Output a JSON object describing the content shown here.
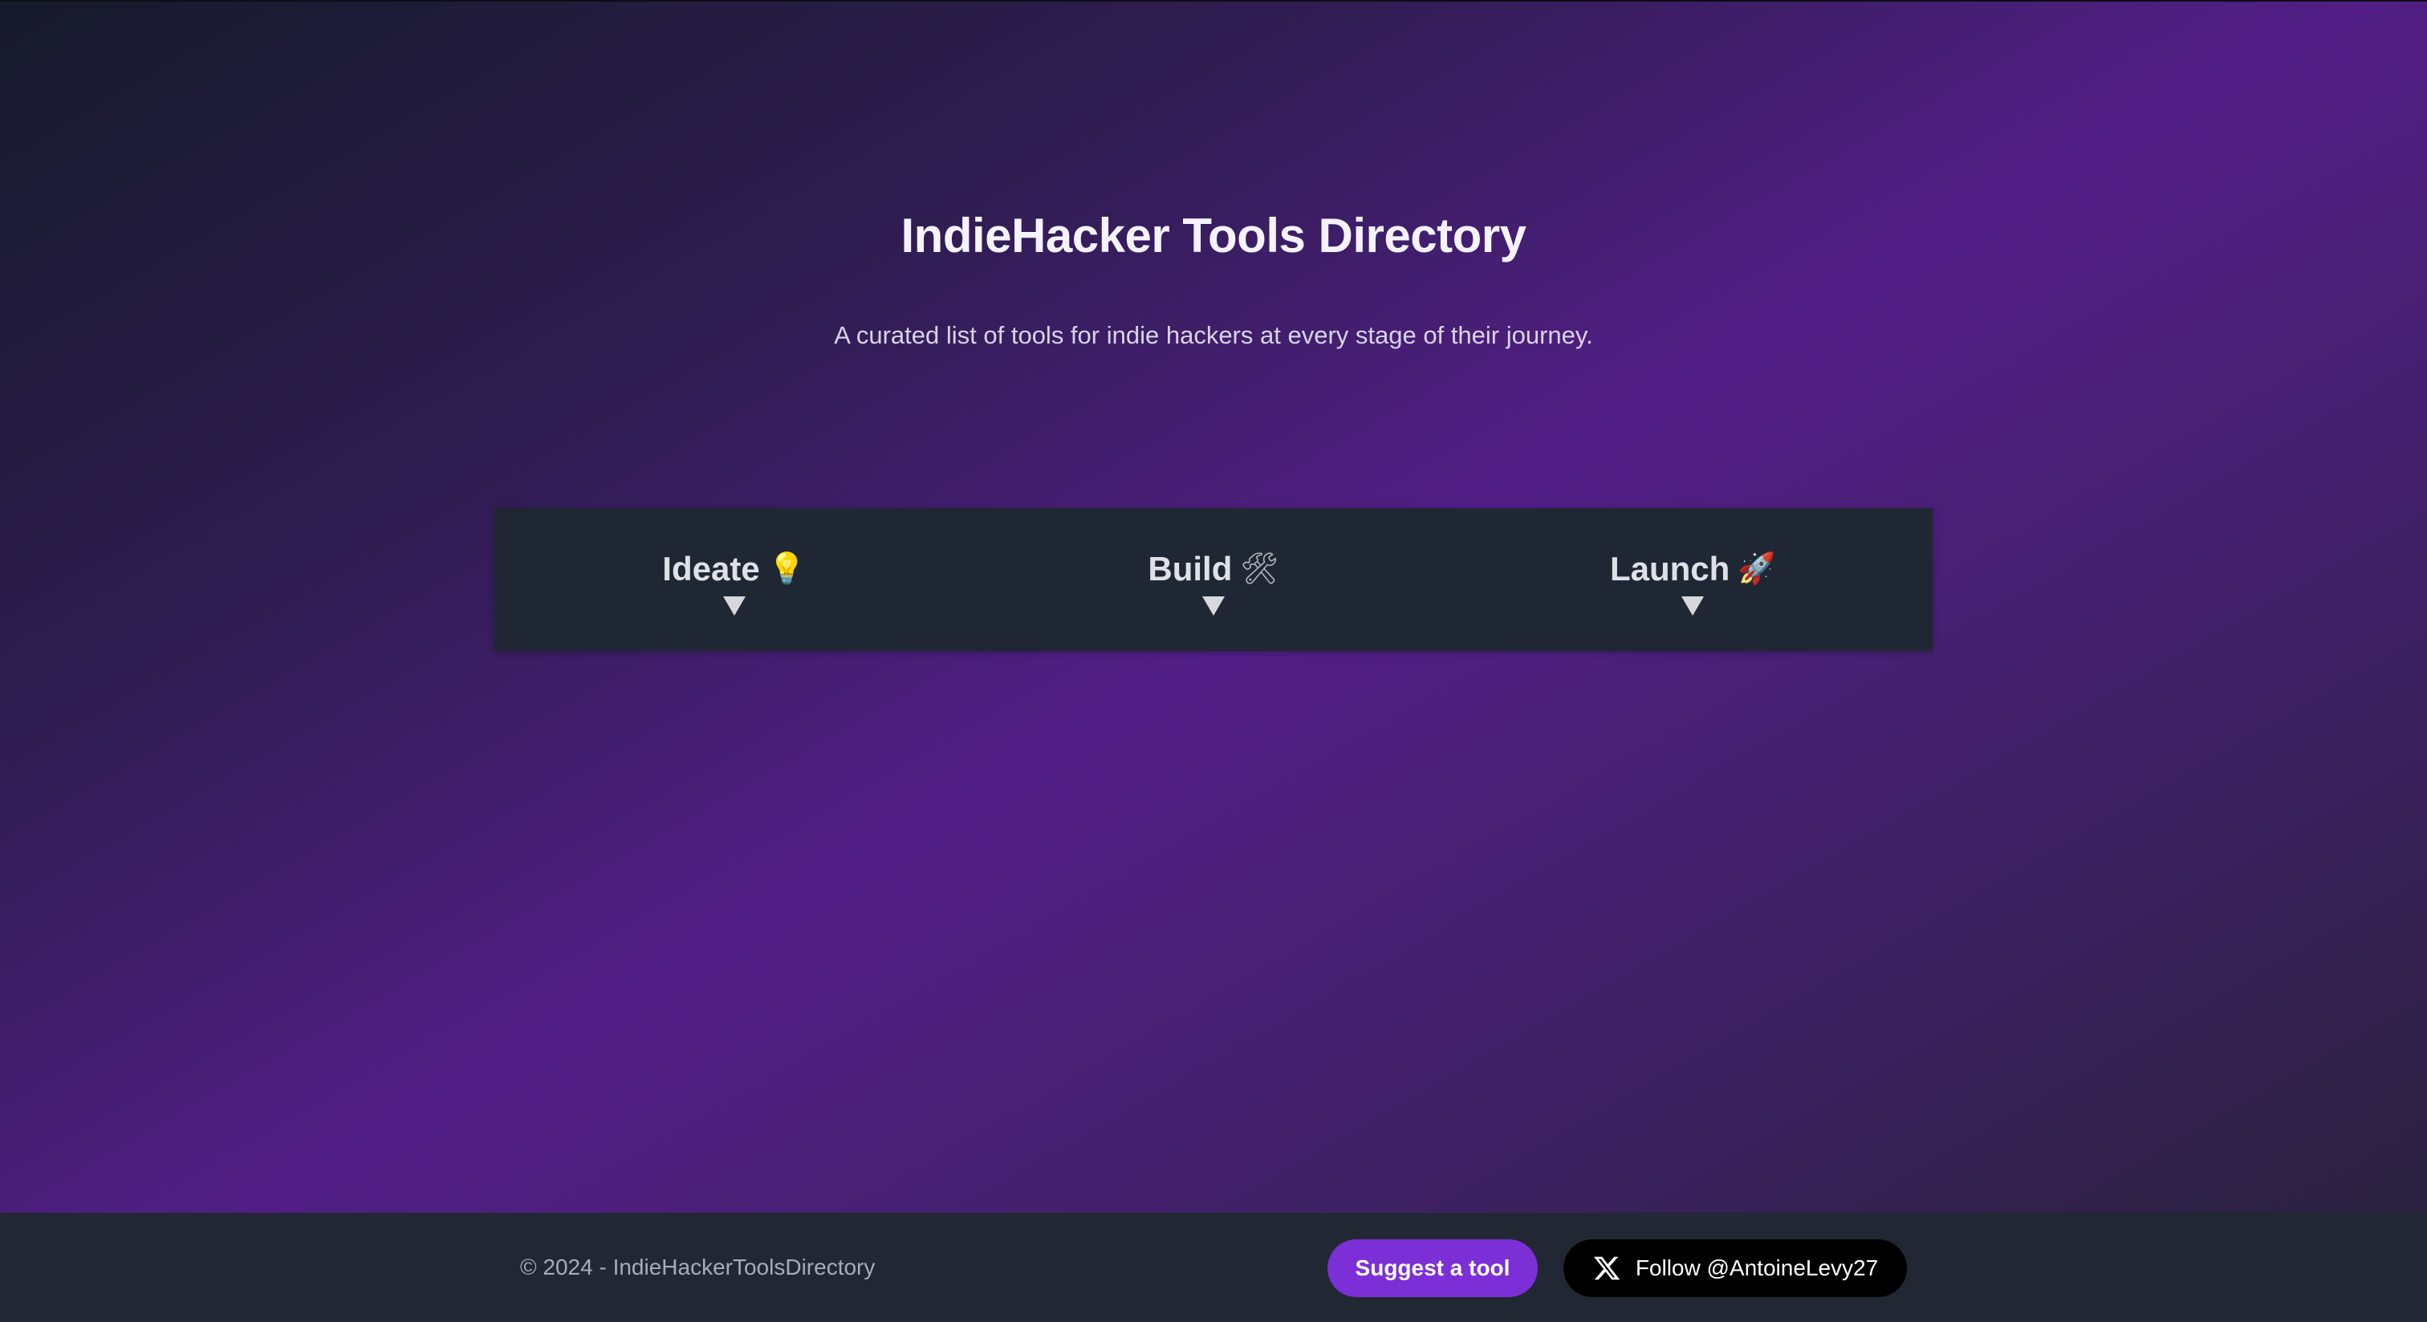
{
  "hero": {
    "title": "IndieHacker Tools Directory",
    "subtitle": "A curated list of tools for indie hackers at every stage of their journey."
  },
  "stages": [
    {
      "label": "Ideate",
      "icon": "lightbulb-icon",
      "glyph": "💡"
    },
    {
      "label": "Build",
      "icon": "tools-icon",
      "glyph": "🛠"
    },
    {
      "label": "Launch",
      "icon": "rocket-icon",
      "glyph": "🚀"
    }
  ],
  "footer": {
    "copyright": "© 2024 - IndieHackerToolsDirectory",
    "suggest_label": "Suggest a tool",
    "follow_label": "Follow @AntoineLevy27",
    "follow_icon": "x-logo-icon"
  },
  "colors": {
    "accent": "#7c2fd6",
    "panel": "#202734",
    "footer": "#212733"
  }
}
